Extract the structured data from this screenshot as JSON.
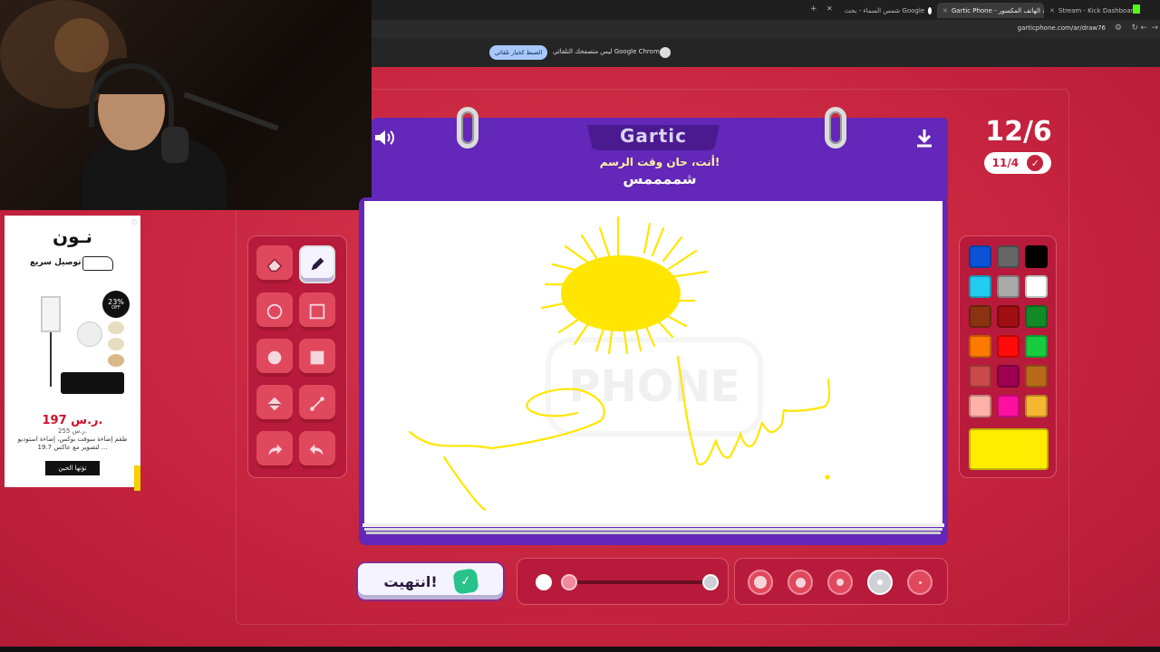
{
  "browser": {
    "tabs": [
      {
        "label": "شمس السماء - بحث Google",
        "active": false
      },
      {
        "label": "Gartic Phone - لعبة الهاتف المكسور",
        "active": true
      },
      {
        "label": "Stream - Kick Dashboard",
        "active": false
      }
    ],
    "url": "garticphone.com/ar/draw76",
    "infobar_text": "Google Chrome ليس متصفحك التلقائي",
    "infobar_button": "الضبط كخيار تلقائي"
  },
  "ad": {
    "logo": "نـون",
    "tagline": "توصيل سريع",
    "discount": "23%",
    "discount_sub": "OFF",
    "price": "197 ر.س.",
    "old_price": "255 ر.س.",
    "description": "طقم إضاءة سوفت بوكس، إضاءة استوديو لتصوير مع عاكس 19.7 ...",
    "cta": "تؤتها الحين"
  },
  "game": {
    "logo": "Gartic",
    "prompt_label": "أنت، حان وقت الرسم!",
    "prompt_word": "شممممس",
    "turn": "12/6",
    "done_count": "11/4",
    "done_button": "انتهيت!",
    "canvas_watermark": "PHONE"
  },
  "palette": {
    "colors": [
      "#0a53d6",
      "#666666",
      "#000000",
      "#22ccf0",
      "#aaaaaa",
      "#ffffff",
      "#8a3310",
      "#a10e12",
      "#128a28",
      "#ff7800",
      "#ff0a0a",
      "#16cc3f",
      "#c84a4a",
      "#a00050",
      "#b86a1a",
      "#ffb0a8",
      "#ff0fa0",
      "#f5b731"
    ],
    "current": "#ffec00"
  },
  "tools": [
    "eraser",
    "pencil",
    "circle-outline",
    "square-outline",
    "circle-filled",
    "square-filled",
    "fill-bucket",
    "line",
    "redo",
    "undo"
  ]
}
